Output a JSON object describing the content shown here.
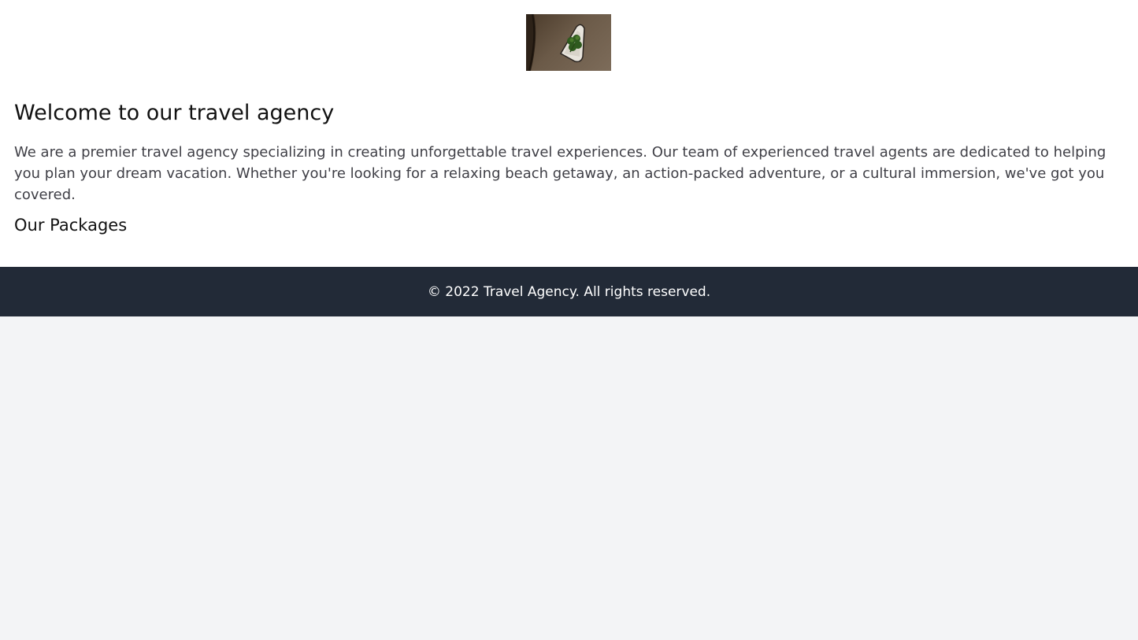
{
  "header": {
    "logo": {
      "icon": "four-leaf-clover-logo"
    }
  },
  "main": {
    "title": "Welcome to our travel agency",
    "intro": "We are a premier travel agency specializing in creating unforgettable travel experiences. Our team of experienced travel agents are dedicated to helping you plan your dream vacation. Whether you're looking for a relaxing beach getaway, an action-packed adventure, or a cultural immersion, we've got you covered.",
    "packages_title": "Our Packages"
  },
  "footer": {
    "copyright": "© 2022 Travel Agency. All rights reserved."
  },
  "colors": {
    "page_background": "#f3f4f6",
    "content_background": "#ffffff",
    "footer_background": "#222a37",
    "footer_text": "#ffffff"
  }
}
